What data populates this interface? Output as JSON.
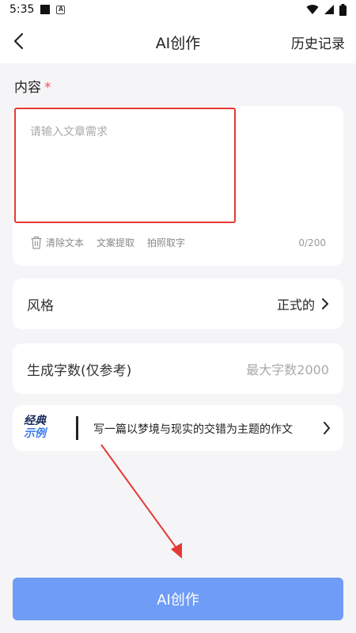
{
  "status_bar": {
    "time": "5:35"
  },
  "nav": {
    "title": "AI创作",
    "history_label": "历史记录"
  },
  "content": {
    "label": "内容",
    "required_mark": "*",
    "placeholder": "请输入文章需求",
    "value": "",
    "tools": [
      {
        "label": "清除文本",
        "icon": "trash-icon"
      },
      {
        "label": "文案提取",
        "icon": ""
      },
      {
        "label": "拍照取字",
        "icon": ""
      }
    ],
    "counter": "0/200"
  },
  "style_row": {
    "label": "风格",
    "value": "正式的"
  },
  "word_count_row": {
    "label": "生成字数(仅参考)",
    "placeholder": "最大字数2000"
  },
  "example": {
    "badge_top": "经典",
    "badge_bottom": "示例",
    "text": "写一篇以梦境与现实的交错为主题的作文"
  },
  "primary_button": {
    "label": "AI创作"
  },
  "colors": {
    "primary": "#6f9cf6",
    "required": "#ff4d4f",
    "annotation": "#e53935",
    "background": "#f5f5f7"
  }
}
